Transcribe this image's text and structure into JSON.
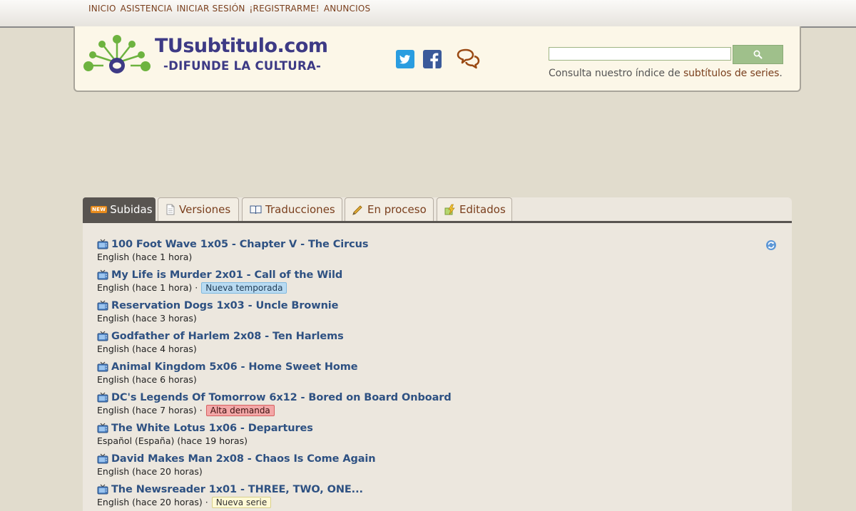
{
  "nav": {
    "items": [
      "INICIO",
      "ASISTENCIA",
      "INICIAR SESIÓN",
      "¡REGISTRARME!",
      "ANUNCIOS"
    ]
  },
  "header": {
    "logo_title": "TUsubtitulo.com",
    "logo_subtitle": "-DIFUNDE LA CULTURA-",
    "search_value": "",
    "consulta_prefix": "Consulta nuestro índice de ",
    "consulta_link": "subtítulos de series",
    "consulta_suffix": "."
  },
  "tabs": [
    {
      "label": "Subidas",
      "icon": "new-icon",
      "badge": "NEW",
      "active": true
    },
    {
      "label": "Versiones",
      "icon": "document-icon",
      "active": false
    },
    {
      "label": "Traducciones",
      "icon": "book-icon",
      "active": false
    },
    {
      "label": "En proceso",
      "icon": "pen-icon",
      "active": false
    },
    {
      "label": "Editados",
      "icon": "lightning-icon",
      "active": false
    }
  ],
  "subtitles": [
    {
      "title": "100 Foot Wave 1x05 - Chapter V - The Circus",
      "meta": "English (hace 1 hora)",
      "badge": ""
    },
    {
      "title": "My Life is Murder 2x01 - Call of the Wild",
      "meta": "English (hace 1 hora) ·",
      "badge": "Nueva temporada"
    },
    {
      "title": "Reservation Dogs 1x03 - Uncle Brownie",
      "meta": "English (hace 3 horas)",
      "badge": ""
    },
    {
      "title": "Godfather of Harlem 2x08 - Ten Harlems",
      "meta": "English (hace 4 horas)",
      "badge": ""
    },
    {
      "title": "Animal Kingdom 5x06 - Home Sweet Home",
      "meta": "English (hace 6 horas)",
      "badge": ""
    },
    {
      "title": "DC's Legends Of Tomorrow 6x12 - Bored on Board Onboard",
      "meta": "English (hace 7 horas) ·",
      "badge": "Alta demanda"
    },
    {
      "title": "The White Lotus 1x06 - Departures",
      "meta": "Español (España) (hace 19 horas)",
      "badge": ""
    },
    {
      "title": "David Makes Man 2x08 - Chaos Is Come Again",
      "meta": "English (hace 20 horas)",
      "badge": ""
    },
    {
      "title": "The Newsreader 1x01 - THREE, TWO, ONE...",
      "meta": "English (hace 20 horas) ·",
      "badge": "Nueva serie"
    }
  ],
  "colors": {
    "accent_link": "#2e5182",
    "nav_link": "#7a3f1d",
    "logo": "#3d3a85",
    "logo_green": "#6db33f"
  }
}
